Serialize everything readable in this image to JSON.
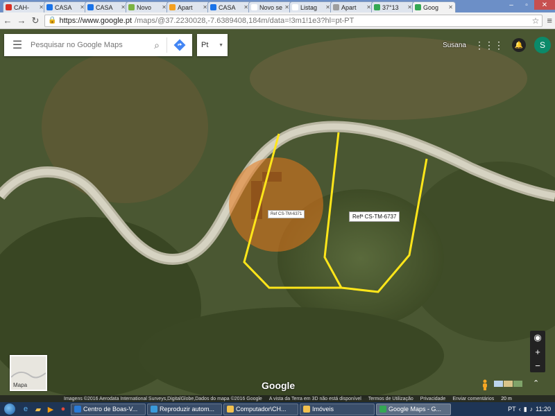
{
  "browser": {
    "tabs": [
      {
        "label": "CAH-",
        "color": "#d93025"
      },
      {
        "label": "CASA",
        "color": "#1a73e8"
      },
      {
        "label": "CASA",
        "color": "#1a73e8"
      },
      {
        "label": "Novo",
        "color": "#7cb342"
      },
      {
        "label": "Apart",
        "color": "#f4a020"
      },
      {
        "label": "CASA",
        "color": "#1a73e8"
      },
      {
        "label": "Novo sep",
        "color": "#ffffff"
      },
      {
        "label": "Listag",
        "color": "#ffffff"
      },
      {
        "label": "Apart",
        "color": "#9e9e9e"
      },
      {
        "label": "37°13",
        "color": "#34a853"
      },
      {
        "label": "Goog",
        "color": "#34a853",
        "active": true
      }
    ],
    "url_host": "https://www.google.pt",
    "url_rest": "/maps/@37.2230028,-7.6389408,184m/data=!3m1!1e3?hl=pt-PT",
    "back_icon": "back-arrow-icon",
    "forward_icon": "forward-arrow-icon",
    "reload_icon": "reload-icon"
  },
  "maps": {
    "search_placeholder": "Pesquisar no Google Maps",
    "language": "Pt",
    "user_name": "Susana",
    "avatar_letter": "S",
    "minimap_label": "Mapa",
    "logo": "Google",
    "ref_label_1": "Ref CS-TM-6371",
    "ref_label_2": "Refª CS-TM-6737",
    "footer": {
      "imagery": "Imagens ©2016 Aerodata International Surveys,DigitalGlobe,Dados do mapa ©2016 Google",
      "earth_note": "A vista da Terra em 3D não está disponível",
      "terms": "Termos de Utilização",
      "privacy": "Privacidade",
      "feedback": "Enviar comentários",
      "scale": "20 m"
    },
    "zoom_in": "+",
    "zoom_out": "−"
  },
  "taskbar": {
    "tasks": [
      {
        "label": "Centro de Boas-V...",
        "color": "#2a7ad6"
      },
      {
        "label": "Reproduzir autom...",
        "color": "#3a9ad9"
      },
      {
        "label": "Computador\\CH...",
        "color": "#f2c14e"
      },
      {
        "label": "Imóveis",
        "color": "#f2c14e"
      },
      {
        "label": "Google Maps - G...",
        "color": "#34a853",
        "active": true
      }
    ],
    "lang": "PT",
    "time": "11:20"
  }
}
